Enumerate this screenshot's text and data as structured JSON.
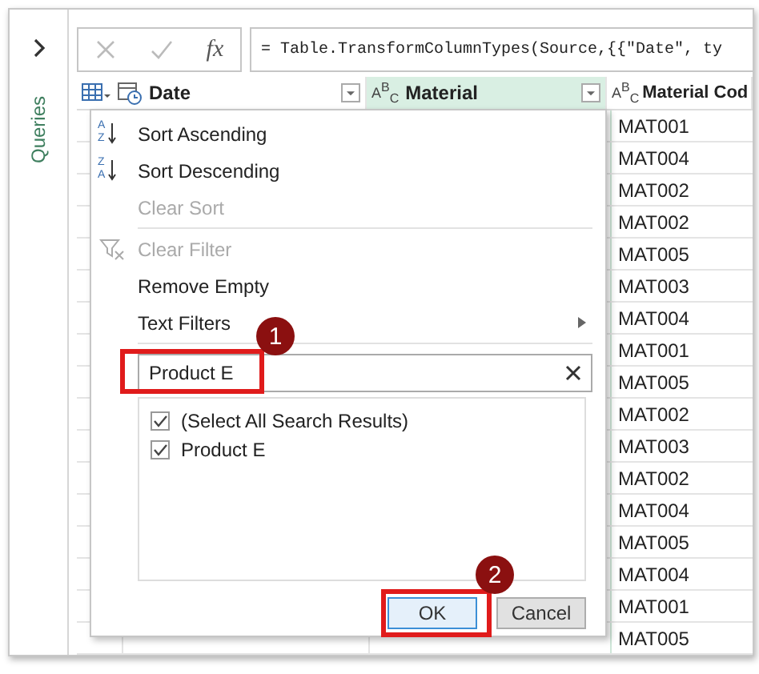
{
  "queries_pane": {
    "label": "Queries"
  },
  "formula_bar": {
    "fx": "fx",
    "formula": "= Table.TransformColumnTypes(Source,{{\"Date\", ty"
  },
  "columns": [
    {
      "name": "Date",
      "kind": "datetime",
      "selected": false
    },
    {
      "name": "Material",
      "kind": "text",
      "type_label": "A$^{B}$$_{C}$",
      "selected": true
    },
    {
      "name": "Material Cod",
      "kind": "text",
      "type_label": "A$^{B}$$_{C}$",
      "selected": false
    }
  ],
  "material_codes": [
    "MAT001",
    "MAT004",
    "MAT002",
    "MAT002",
    "MAT005",
    "MAT003",
    "MAT004",
    "MAT001",
    "MAT005",
    "MAT002",
    "MAT003",
    "MAT002",
    "MAT004",
    "MAT005",
    "MAT004",
    "MAT001",
    "MAT005"
  ],
  "filter_menu": {
    "groups": [
      [
        {
          "label": "Sort Ascending",
          "kind": "sort",
          "icon_letters": "AZ",
          "disabled": false
        },
        {
          "label": "Sort Descending",
          "kind": "sort",
          "icon_letters": "ZA",
          "disabled": false
        },
        {
          "label": "Clear Sort",
          "kind": "plain",
          "disabled": true
        }
      ],
      [
        {
          "label": "Clear Filter",
          "kind": "clear_filter",
          "disabled": true
        },
        {
          "label": "Remove Empty",
          "kind": "plain",
          "disabled": false
        },
        {
          "label": "Text Filters",
          "kind": "submenu",
          "disabled": false
        }
      ]
    ],
    "search": {
      "value": "Product E"
    },
    "values": [
      {
        "label": "(Select All Search Results)",
        "checked": true
      },
      {
        "label": "Product E",
        "checked": true
      }
    ],
    "buttons": [
      {
        "label": "OK",
        "focused": true
      },
      {
        "label": "Cancel",
        "focused": false
      }
    ]
  },
  "callouts": [
    {
      "number": "1"
    },
    {
      "number": "2"
    }
  ]
}
